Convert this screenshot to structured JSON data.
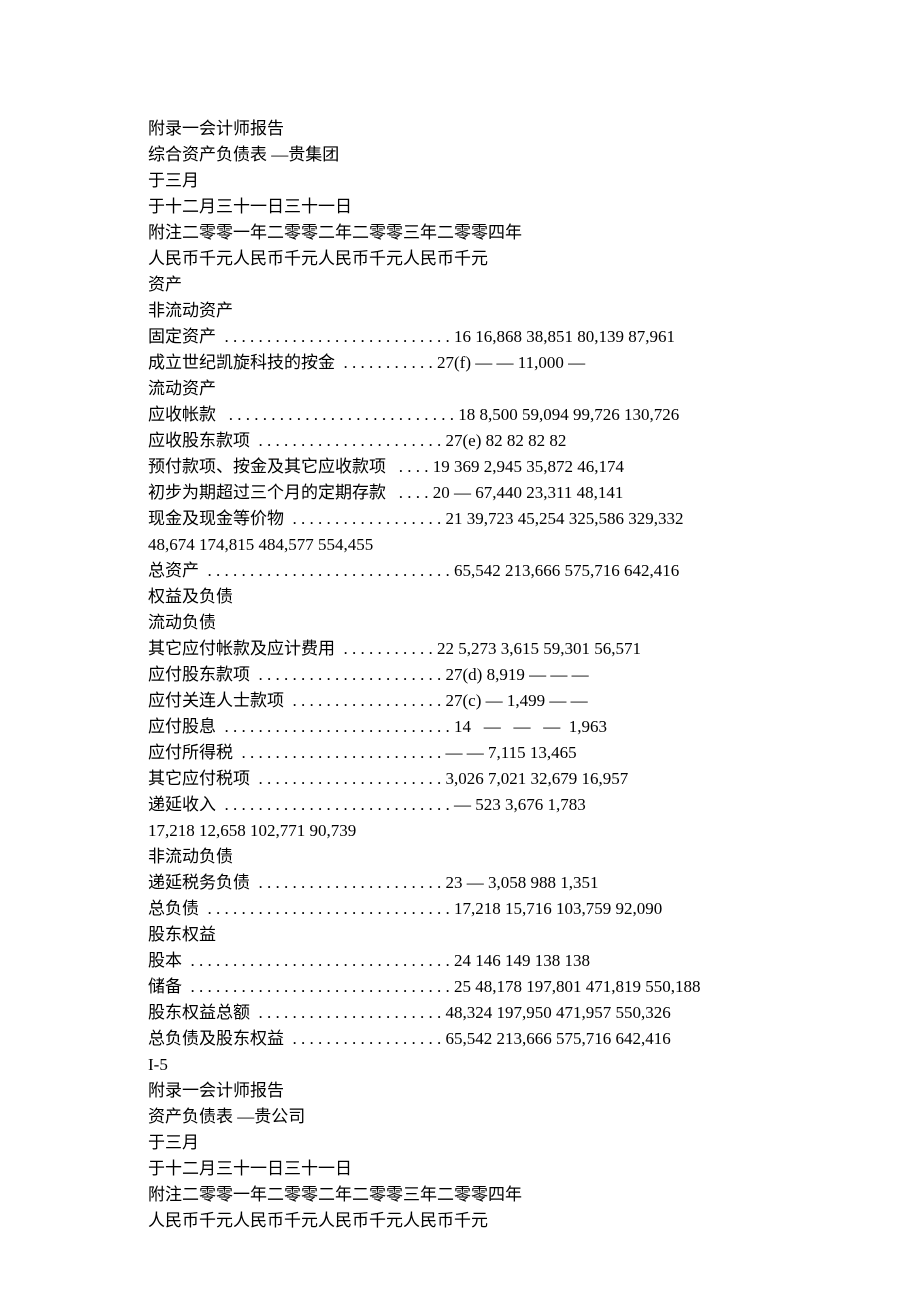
{
  "lines": [
    "附录一会计师报告",
    "综合资产负债表 —贵集团",
    "于三月",
    "于十二月三十一日三十一日",
    "附注二零零一年二零零二年二零零三年二零零四年",
    "人民币千元人民币千元人民币千元人民币千元",
    "资产",
    "非流动资产",
    "固定资产  . . . . . . . . . . . . . . . . . . . . . . . . . . . 16 16,868 38,851 80,139 87,961",
    "成立世纪凯旋科技的按金  . . . . . . . . . . . 27(f) — — 11,000 —",
    "流动资产",
    "应收帐款   . . . . . . . . . . . . . . . . . . . . . . . . . . . 18 8,500 59,094 99,726 130,726",
    "应收股东款项  . . . . . . . . . . . . . . . . . . . . . . 27(e) 82 82 82 82",
    "预付款项、按金及其它应收款项   . . . . 19 369 2,945 35,872 46,174",
    "初步为期超过三个月的定期存款   . . . . 20 — 67,440 23,311 48,141",
    "现金及现金等价物  . . . . . . . . . . . . . . . . . . 21 39,723 45,254 325,586 329,332",
    "48,674 174,815 484,577 554,455",
    "总资产  . . . . . . . . . . . . . . . . . . . . . . . . . . . . . 65,542 213,666 575,716 642,416",
    "权益及负债",
    "流动负债",
    "其它应付帐款及应计费用  . . . . . . . . . . . 22 5,273 3,615 59,301 56,571",
    "应付股东款项  . . . . . . . . . . . . . . . . . . . . . . 27(d) 8,919 — — —",
    "应付关连人士款项  . . . . . . . . . . . . . . . . . . 27(c) — 1,499 — —",
    "应付股息  . . . . . . . . . . . . . . . . . . . . . . . . . . . 14   —   —   —  1,963",
    "应付所得税  . . . . . . . . . . . . . . . . . . . . . . . . — — 7,115 13,465",
    "其它应付税项  . . . . . . . . . . . . . . . . . . . . . . 3,026 7,021 32,679 16,957",
    "递延收入  . . . . . . . . . . . . . . . . . . . . . . . . . . . — 523 3,676 1,783",
    "17,218 12,658 102,771 90,739",
    "非流动负债",
    "递延税务负债  . . . . . . . . . . . . . . . . . . . . . . 23 — 3,058 988 1,351",
    "总负债  . . . . . . . . . . . . . . . . . . . . . . . . . . . . . 17,218 15,716 103,759 92,090",
    "股东权益",
    "股本  . . . . . . . . . . . . . . . . . . . . . . . . . . . . . . . 24 146 149 138 138",
    "储备  . . . . . . . . . . . . . . . . . . . . . . . . . . . . . . . 25 48,178 197,801 471,819 550,188",
    "股东权益总额  . . . . . . . . . . . . . . . . . . . . . . 48,324 197,950 471,957 550,326",
    "总负债及股东权益  . . . . . . . . . . . . . . . . . . 65,542 213,666 575,716 642,416",
    "",
    "I-5",
    "附录一会计师报告",
    "资产负债表 —贵公司",
    "于三月",
    "于十二月三十一日三十一日",
    "附注二零零一年二零零二年二零零三年二零零四年",
    "人民币千元人民币千元人民币千元人民币千元"
  ]
}
